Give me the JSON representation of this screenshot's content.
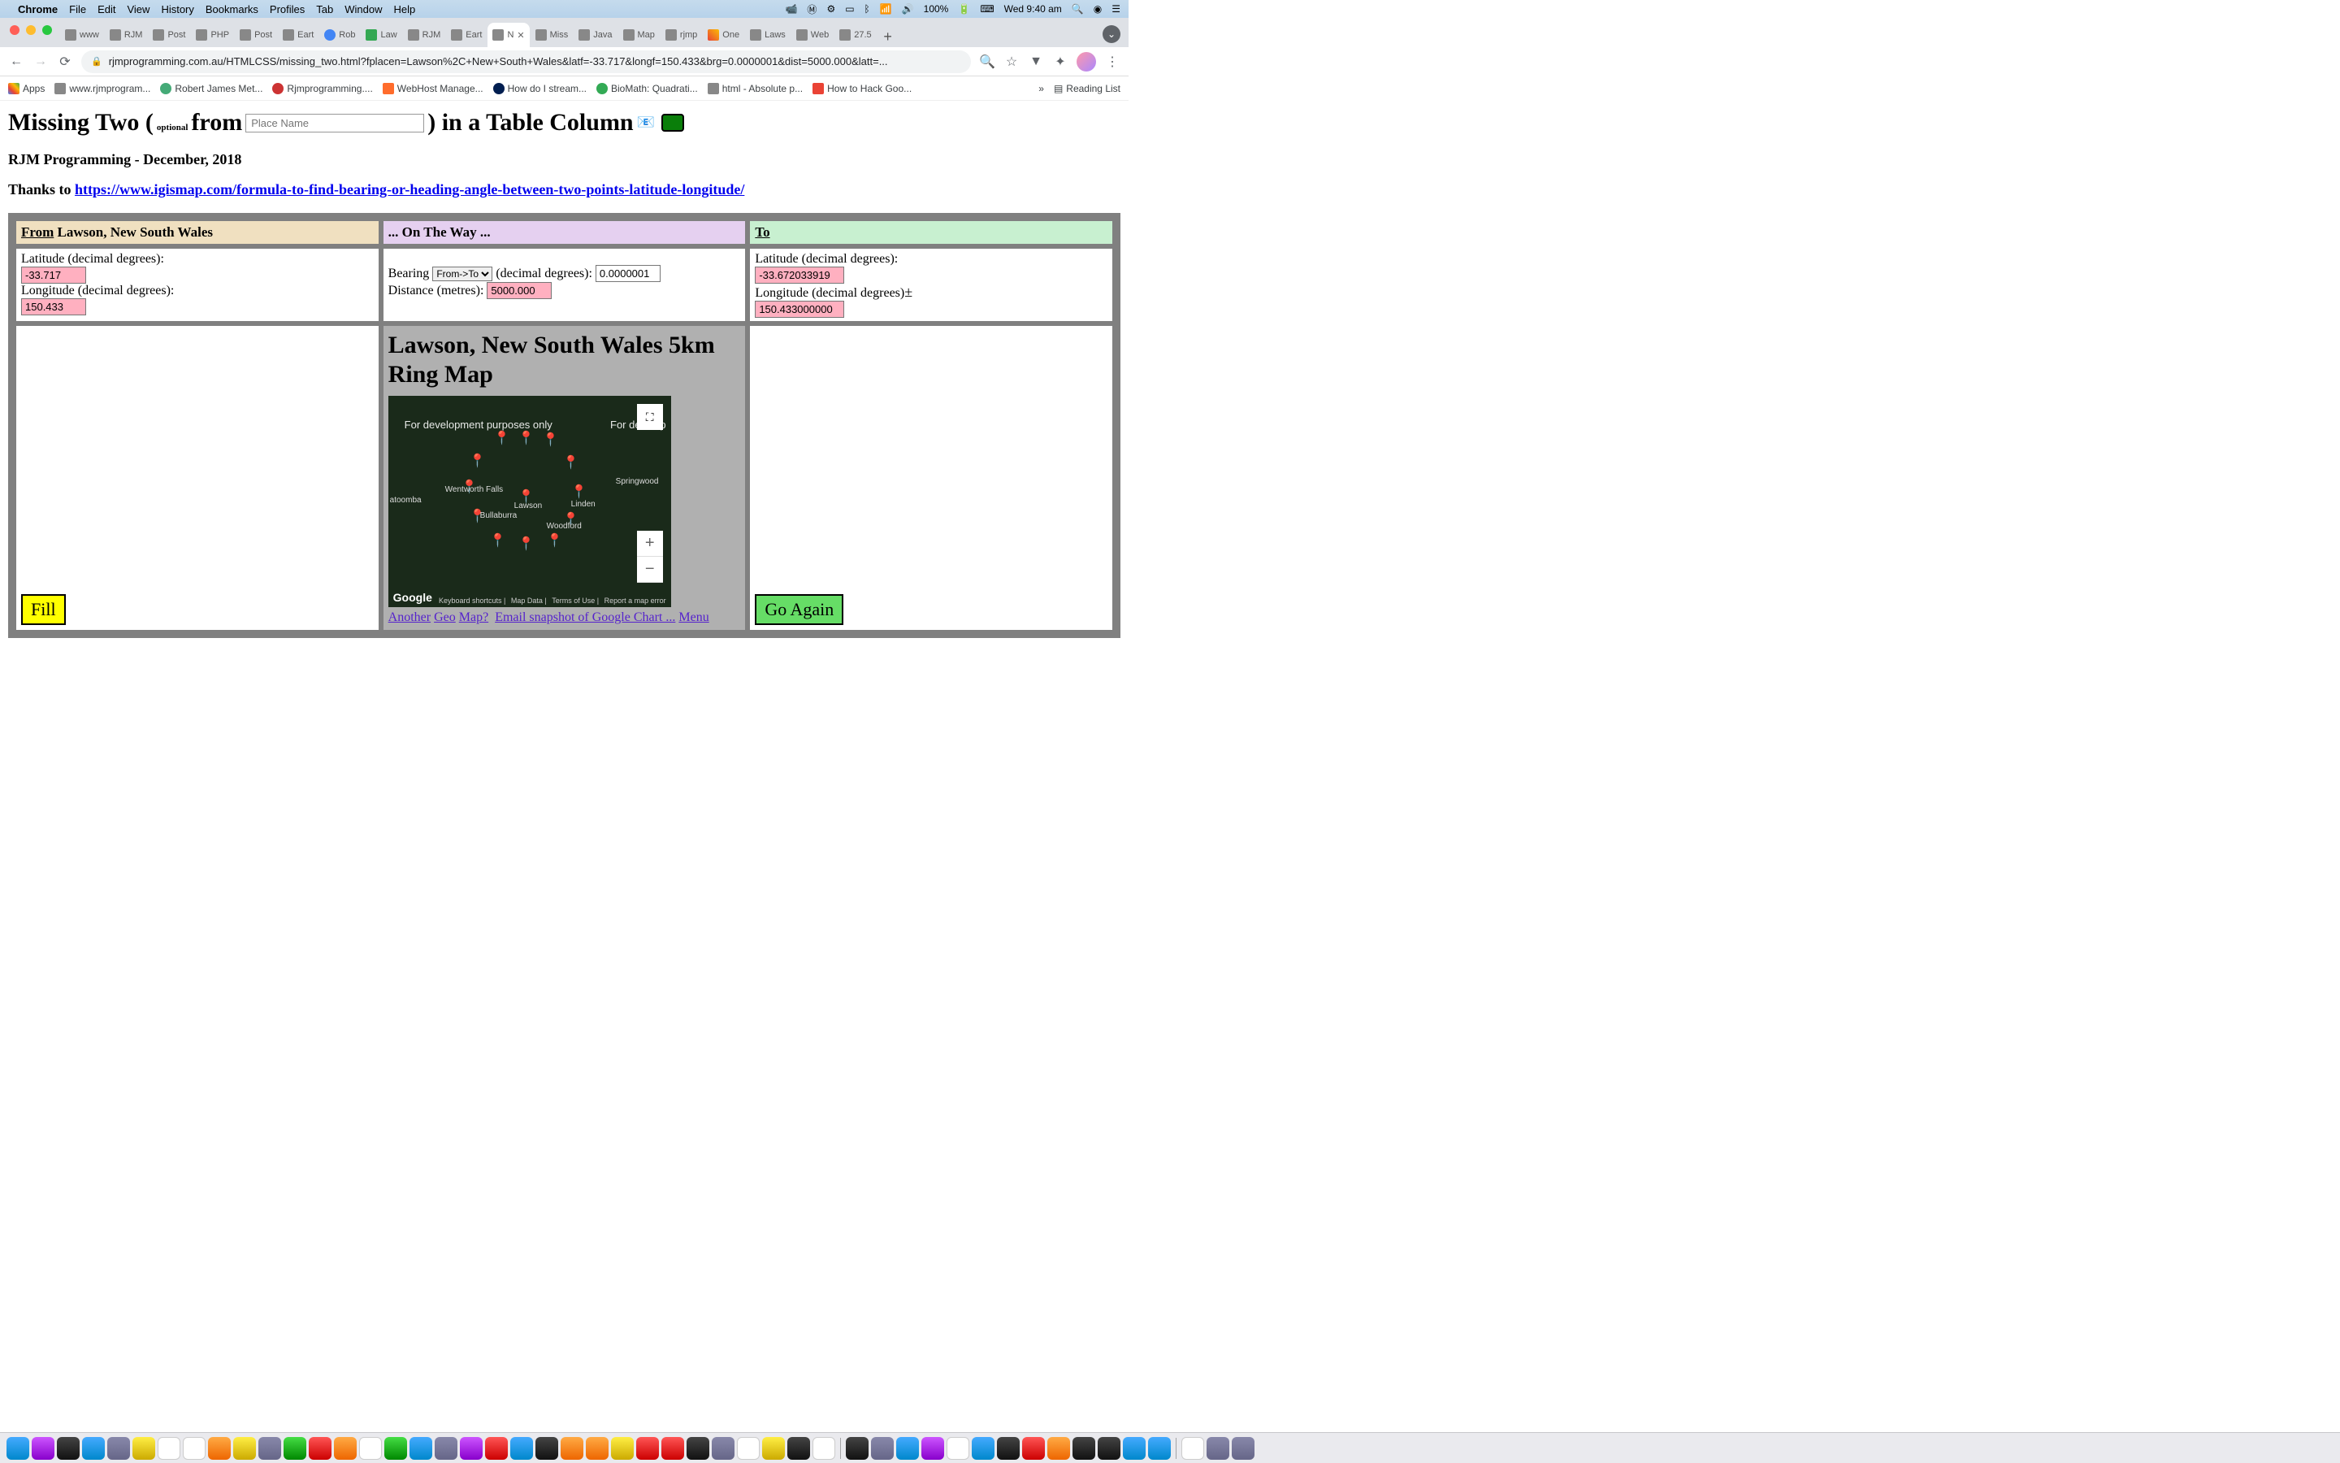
{
  "menubar": {
    "app": "Chrome",
    "items": [
      "File",
      "Edit",
      "View",
      "History",
      "Bookmarks",
      "Profiles",
      "Tab",
      "Window",
      "Help"
    ],
    "battery": "100%",
    "clock": "Wed 9:40 am"
  },
  "tabs": [
    {
      "label": "www"
    },
    {
      "label": "RJM"
    },
    {
      "label": "Post"
    },
    {
      "label": "PHP"
    },
    {
      "label": "Post"
    },
    {
      "label": "Eart"
    },
    {
      "label": "Rob"
    },
    {
      "label": "Law"
    },
    {
      "label": "RJM"
    },
    {
      "label": "Eart"
    },
    {
      "label": "N",
      "active": true
    },
    {
      "label": "Miss"
    },
    {
      "label": "Java"
    },
    {
      "label": "Map"
    },
    {
      "label": "rjmp"
    },
    {
      "label": "One"
    },
    {
      "label": "Laws"
    },
    {
      "label": "Web"
    },
    {
      "label": "27.5"
    }
  ],
  "omnibox": "rjmprogramming.com.au/HTMLCSS/missing_two.html?fplacen=Lawson%2C+New+South+Wales&latf=-33.717&longf=150.433&brg=0.0000001&dist=5000.000&latt=...",
  "bookmarks": {
    "items": [
      "Apps",
      "www.rjmprogram...",
      "Robert James Met...",
      "Rjmprogramming....",
      "WebHost Manage...",
      "How do I stream...",
      "BioMath: Quadrati...",
      "html - Absolute p...",
      "How to Hack Goo..."
    ],
    "overflow": "»",
    "reading": "Reading List"
  },
  "title": {
    "pre": "Missing Two (",
    "optional": "optional",
    "from": "from",
    "placeholder": "Place Name",
    "post": ") in a Table Column"
  },
  "subtitle": "RJM Programming - December, 2018",
  "thanks": {
    "label": "Thanks to ",
    "link": "https://www.igismap.com/formula-to-find-bearing-or-heading-angle-between-two-points-latitude-longitude/"
  },
  "table": {
    "from": {
      "header_u": "From",
      "header_rest": " Lawson, New South Wales",
      "lat_label": "Latitude (decimal degrees):",
      "lat_val": "-33.717",
      "lon_label": "Longitude (decimal degrees):",
      "lon_val": "150.433"
    },
    "ontheway": {
      "header": "... On The Way ...",
      "bearing_label": "Bearing ",
      "bearing_select": "From->To",
      "deg_label": " (decimal degrees): ",
      "bearing_val": "0.0000001",
      "dist_label": "Distance (metres): ",
      "dist_val": "5000.000"
    },
    "to": {
      "header_u": "To",
      "lat_label": "Latitude (decimal degrees):",
      "lat_val": "-33.672033919",
      "lon_label": "Longitude (decimal degrees)",
      "lon_val": "150.433000000"
    }
  },
  "map": {
    "title": "Lawson, New South Wales 5km Ring Map",
    "dev_text": "For development purposes only",
    "dev_text2": "For develop",
    "towns": [
      "atoomba",
      "Wentworth Falls",
      "Lawson",
      "Bullaburra",
      "Woodford",
      "Linden",
      "Springwood"
    ],
    "footer": {
      "kb": "Keyboard shortcuts",
      "md": "Map Data",
      "tou": "Terms of Use",
      "err": "Report a map error"
    },
    "google": "Google",
    "links": {
      "another": "Another",
      "geo": "Geo",
      "mapq": "Map?",
      "email": "Email snapshot of Google Chart ...",
      "menu": "Menu"
    }
  },
  "buttons": {
    "fill": "Fill",
    "go": "Go Again"
  }
}
